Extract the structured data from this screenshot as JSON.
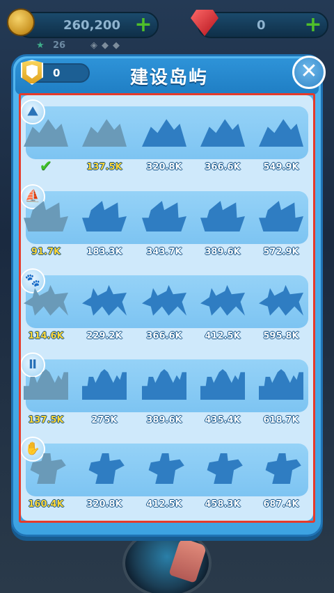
{
  "hud": {
    "coins": "260,200",
    "gems": "0",
    "stars": "26",
    "coin_icon": "gold-coin-icon",
    "gem_icon": "red-gem-icon"
  },
  "modal": {
    "title": "建设岛屿",
    "shield_count": "0",
    "close_label": "✕",
    "accent_color": "#3da3e2",
    "highlight_color": "#e63a2a"
  },
  "rows": [
    {
      "icon": "⛰",
      "icon_name": "mountain-icon",
      "kind": "mountain",
      "owned_index": 1,
      "items": [
        {
          "status": "complete",
          "label": "✔"
        },
        {
          "status": "current",
          "label": "137.5K"
        },
        {
          "status": "locked",
          "label": "320.8K"
        },
        {
          "status": "locked",
          "label": "366.6K"
        },
        {
          "status": "locked",
          "label": "549.9K"
        }
      ]
    },
    {
      "icon": "⛵",
      "icon_name": "ship-icon",
      "kind": "ship",
      "owned_index": 0,
      "items": [
        {
          "status": "current",
          "label": "91.7K"
        },
        {
          "status": "locked",
          "label": "183.3K"
        },
        {
          "status": "locked",
          "label": "343.7K"
        },
        {
          "status": "locked",
          "label": "389.6K"
        },
        {
          "status": "locked",
          "label": "572.9K"
        }
      ]
    },
    {
      "icon": "🐾",
      "icon_name": "paw-icon",
      "kind": "wolf",
      "owned_index": 0,
      "items": [
        {
          "status": "current",
          "label": "114.6K"
        },
        {
          "status": "locked",
          "label": "229.2K"
        },
        {
          "status": "locked",
          "label": "366.6K"
        },
        {
          "status": "locked",
          "label": "412.5K"
        },
        {
          "status": "locked",
          "label": "595.8K"
        }
      ]
    },
    {
      "icon": "Ⅱ",
      "icon_name": "pillar-icon",
      "kind": "palace",
      "owned_index": 0,
      "items": [
        {
          "status": "current",
          "label": "137.5K"
        },
        {
          "status": "locked",
          "label": "275K"
        },
        {
          "status": "locked",
          "label": "389.6K"
        },
        {
          "status": "locked",
          "label": "435.4K"
        },
        {
          "status": "locked",
          "label": "618.7K"
        }
      ]
    },
    {
      "icon": "✋",
      "icon_name": "statue-hand-icon",
      "kind": "cupid",
      "owned_index": 0,
      "items": [
        {
          "status": "current",
          "label": "160.4K"
        },
        {
          "status": "locked",
          "label": "320.8K"
        },
        {
          "status": "locked",
          "label": "412.5K"
        },
        {
          "status": "locked",
          "label": "458.3K"
        },
        {
          "status": "locked",
          "label": "687.4K"
        }
      ]
    }
  ]
}
